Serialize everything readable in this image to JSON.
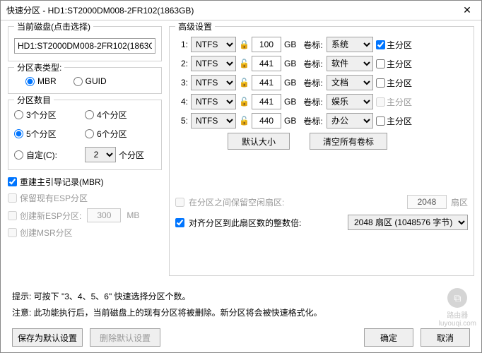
{
  "window": {
    "title": "快速分区 - HD1:ST2000DM008-2FR102(1863GB)",
    "close_icon": "✕"
  },
  "left": {
    "current_disk_legend": "当前磁盘(点击选择)",
    "current_disk_value": "HD1:ST2000DM008-2FR102(1863G",
    "table_type_legend": "分区表类型:",
    "table_type": {
      "mbr": "MBR",
      "guid": "GUID"
    },
    "count_legend": "分区数目",
    "counts": {
      "c3": "3个分区",
      "c4": "4个分区",
      "c5": "5个分区",
      "c6": "6个分区",
      "custom": "自定(C):",
      "custom_val": "2",
      "custom_suffix": "个分区"
    },
    "rebuild_mbr": "重建主引导记录(MBR)",
    "keep_esp": "保留现有ESP分区",
    "create_esp": "创建新ESP分区:",
    "esp_size": "300",
    "mb": "MB",
    "create_msr": "创建MSR分区"
  },
  "right": {
    "adv_legend": "高级设置",
    "gb": "GB",
    "lab": "卷标:",
    "primary": "主分区",
    "partitions": [
      {
        "idx": "1:",
        "fs": "NTFS",
        "lock": "🔒",
        "size": "100",
        "label": "系统",
        "primary_checked": true,
        "primary_enabled": true
      },
      {
        "idx": "2:",
        "fs": "NTFS",
        "lock": "🔓",
        "size": "441",
        "label": "软件",
        "primary_checked": false,
        "primary_enabled": true
      },
      {
        "idx": "3:",
        "fs": "NTFS",
        "lock": "🔓",
        "size": "441",
        "label": "文档",
        "primary_checked": false,
        "primary_enabled": true
      },
      {
        "idx": "4:",
        "fs": "NTFS",
        "lock": "🔓",
        "size": "441",
        "label": "娱乐",
        "primary_checked": false,
        "primary_enabled": false
      },
      {
        "idx": "5:",
        "fs": "NTFS",
        "lock": "🔓",
        "size": "440",
        "label": "办公",
        "primary_checked": false,
        "primary_enabled": true
      }
    ],
    "btn_default_size": "默认大小",
    "btn_clear_labels": "清空所有卷标",
    "reserve_sectors_label": "在分区之间保留空闲扇区:",
    "reserve_sectors_value": "2048",
    "sector_unit": "扇区",
    "align_label": "对齐分区到此扇区数的整数倍:",
    "align_value": "2048 扇区 (1048576 字节)"
  },
  "hints": {
    "h1": "提示: 可按下 \"3、4、5、6\" 快速选择分区个数。",
    "h2": "注意: 此功能执行后，当前磁盘上的现有分区将被删除。新分区将会被快速格式化。"
  },
  "footer": {
    "save_default": "保存为默认设置",
    "delete_default": "删除默认设置",
    "ok": "确定",
    "cancel": "取消"
  },
  "watermark": {
    "text1": "路由器",
    "text2": "luyouqi.com"
  }
}
